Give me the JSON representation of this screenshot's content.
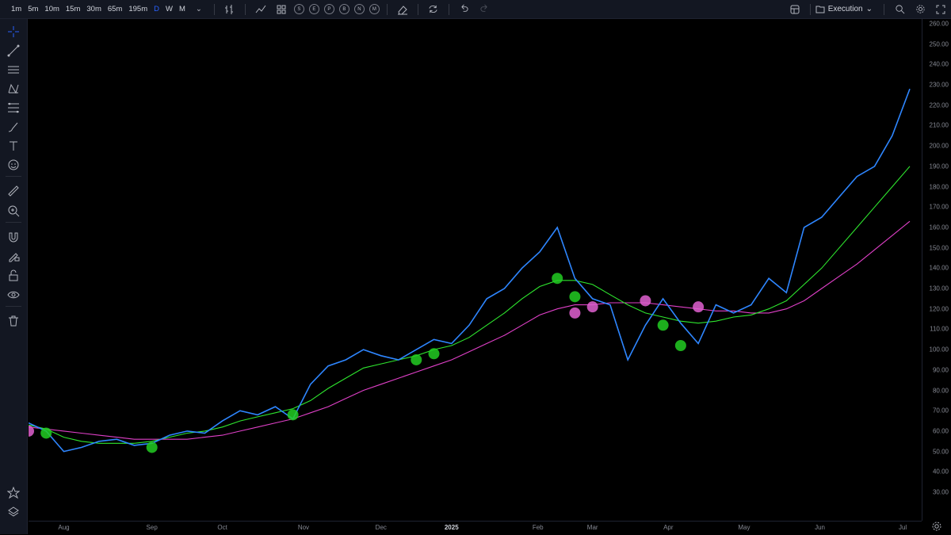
{
  "toolbar": {
    "timeframes": [
      "1m",
      "5m",
      "10m",
      "15m",
      "30m",
      "65m",
      "195m",
      "D",
      "W",
      "M"
    ],
    "active_timeframe": "D",
    "event_badges": [
      "S",
      "E",
      "P",
      "B",
      "N",
      "M"
    ],
    "layout_name": "Execution"
  },
  "colors": {
    "price": "#2e86ff",
    "ema_fast": "#2ee62e",
    "ema_slow": "#e040c8",
    "accent": "#2962ff",
    "marker_green": "#22cc22",
    "marker_pink": "#e060d0"
  },
  "chart_data": {
    "type": "line",
    "x": [
      "Jul 19",
      "Jul 25",
      "Aug 1",
      "Aug 8",
      "Aug 15",
      "Aug 22",
      "Aug 29",
      "Sep 5",
      "Sep 12",
      "Sep 19",
      "Sep 26",
      "Oct 3",
      "Oct 10",
      "Oct 17",
      "Oct 24",
      "Oct 31",
      "Nov 7",
      "Nov 14",
      "Nov 21",
      "Nov 28",
      "Dec 5",
      "Dec 12",
      "Dec 19",
      "Dec 26",
      "Jan 2",
      "Jan 9",
      "Jan 16",
      "Jan 23",
      "Jan 30",
      "Feb 6",
      "Feb 13",
      "Feb 18",
      "Feb 24",
      "Mar 3",
      "Mar 10",
      "Mar 17",
      "Mar 24",
      "Mar 31",
      "Apr 7",
      "Apr 14",
      "Apr 21",
      "Apr 28",
      "May 5",
      "May 12",
      "May 19",
      "May 26",
      "Jun 2",
      "Jun 9",
      "Jun 16",
      "Jun 23",
      "Jun 30"
    ],
    "series": [
      {
        "values": [
          64,
          60,
          50,
          52,
          55,
          56,
          53,
          54,
          58,
          60,
          59,
          65,
          70,
          68,
          72,
          66,
          83,
          92,
          95,
          100,
          97,
          95,
          100,
          105,
          103,
          112,
          125,
          130,
          140,
          148,
          160,
          135,
          125,
          122,
          95,
          112,
          125,
          113,
          103,
          122,
          118,
          122,
          135,
          128,
          160,
          165,
          175,
          185,
          190,
          205,
          228
        ]
      },
      {
        "values": [
          63,
          61,
          57,
          55,
          54,
          54,
          54,
          55,
          57,
          59,
          60,
          62,
          65,
          67,
          69,
          71,
          75,
          81,
          86,
          91,
          93,
          95,
          97,
          100,
          102,
          106,
          112,
          118,
          125,
          131,
          134,
          134,
          132,
          127,
          122,
          118,
          116,
          114,
          113,
          114,
          116,
          117,
          120,
          124,
          132,
          140,
          150,
          160,
          170,
          180,
          190
        ]
      },
      {
        "values": [
          62,
          61,
          60,
          59,
          58,
          57,
          56,
          56,
          56,
          56,
          57,
          58,
          60,
          62,
          64,
          66,
          69,
          72,
          76,
          80,
          83,
          86,
          89,
          92,
          95,
          99,
          103,
          107,
          112,
          117,
          120,
          122,
          122,
          123,
          123,
          123,
          122,
          121,
          120,
          119,
          119,
          118,
          118,
          120,
          124,
          130,
          136,
          142,
          149,
          156,
          163
        ]
      }
    ],
    "ylim": [
      30,
      260
    ],
    "y_ticks": [
      "260.00",
      "250.00",
      "240.00",
      "230.00",
      "220.00",
      "210.00",
      "200.00",
      "190.00",
      "180.00",
      "170.00",
      "160.00",
      "150.00",
      "140.00",
      "130.00",
      "120.00",
      "110.00",
      "100.00",
      "90.00",
      "80.00",
      "70.00",
      "60.00",
      "50.00",
      "40.00",
      "30.00"
    ],
    "x_ticks": [
      "Aug",
      "Sep",
      "Oct",
      "Nov",
      "Dec",
      "2025",
      "Feb",
      "Mar",
      "Apr",
      "May",
      "Jun",
      "Jul"
    ],
    "markers_green": [
      {
        "x": "Jul 25",
        "y": 59
      },
      {
        "x": "Sep 5",
        "y": 52
      },
      {
        "x": "Oct 31",
        "y": 68
      },
      {
        "x": "Dec 19",
        "y": 95
      },
      {
        "x": "Dec 26",
        "y": 98
      },
      {
        "x": "Feb 13",
        "y": 135
      },
      {
        "x": "Feb 18",
        "y": 126
      },
      {
        "x": "Mar 24",
        "y": 112
      },
      {
        "x": "Mar 31",
        "y": 102
      }
    ],
    "markers_pink": [
      {
        "x": "Jul 19",
        "y": 60
      },
      {
        "x": "Feb 18",
        "y": 118
      },
      {
        "x": "Feb 24",
        "y": 121
      },
      {
        "x": "Mar 17",
        "y": 124
      },
      {
        "x": "Apr 7",
        "y": 121
      }
    ],
    "grid": false
  }
}
